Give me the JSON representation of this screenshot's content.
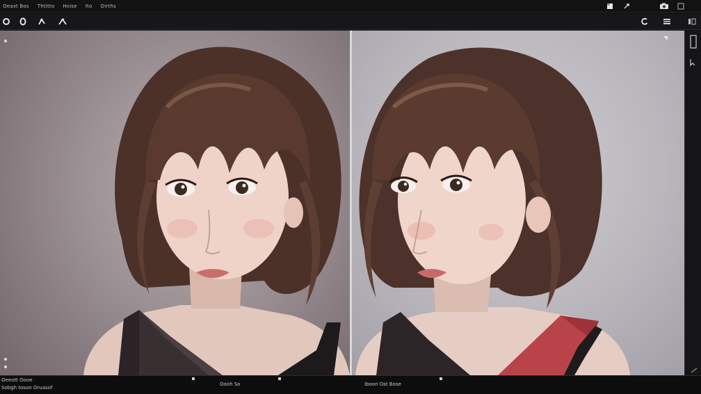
{
  "menu": {
    "items": [
      "Oeaxt Bos",
      "Thtitto",
      "Hoise",
      "Ito",
      "Oirths"
    ]
  },
  "icons": {
    "menu_right": [
      "document-icon",
      "pin-icon",
      "camera-icon",
      "window-icon"
    ],
    "toolbar_left": [
      "circle-tool-icon",
      "lasso-tool-icon",
      "arrow-tool-icon",
      "move-tool-icon"
    ],
    "toolbar_right": [
      "rotate-icon",
      "layers-icon"
    ],
    "rail": [
      "panel-icon",
      "cursor-icon"
    ]
  },
  "status": {
    "left_top": "Oeeott Oooe",
    "left_bottom": "Sobgh toson Oruasof",
    "center": "Oooh So",
    "right": "Iboon Ost Bose"
  },
  "colors": {
    "background": "#0f0f10",
    "divider": "#d8d8d8"
  }
}
